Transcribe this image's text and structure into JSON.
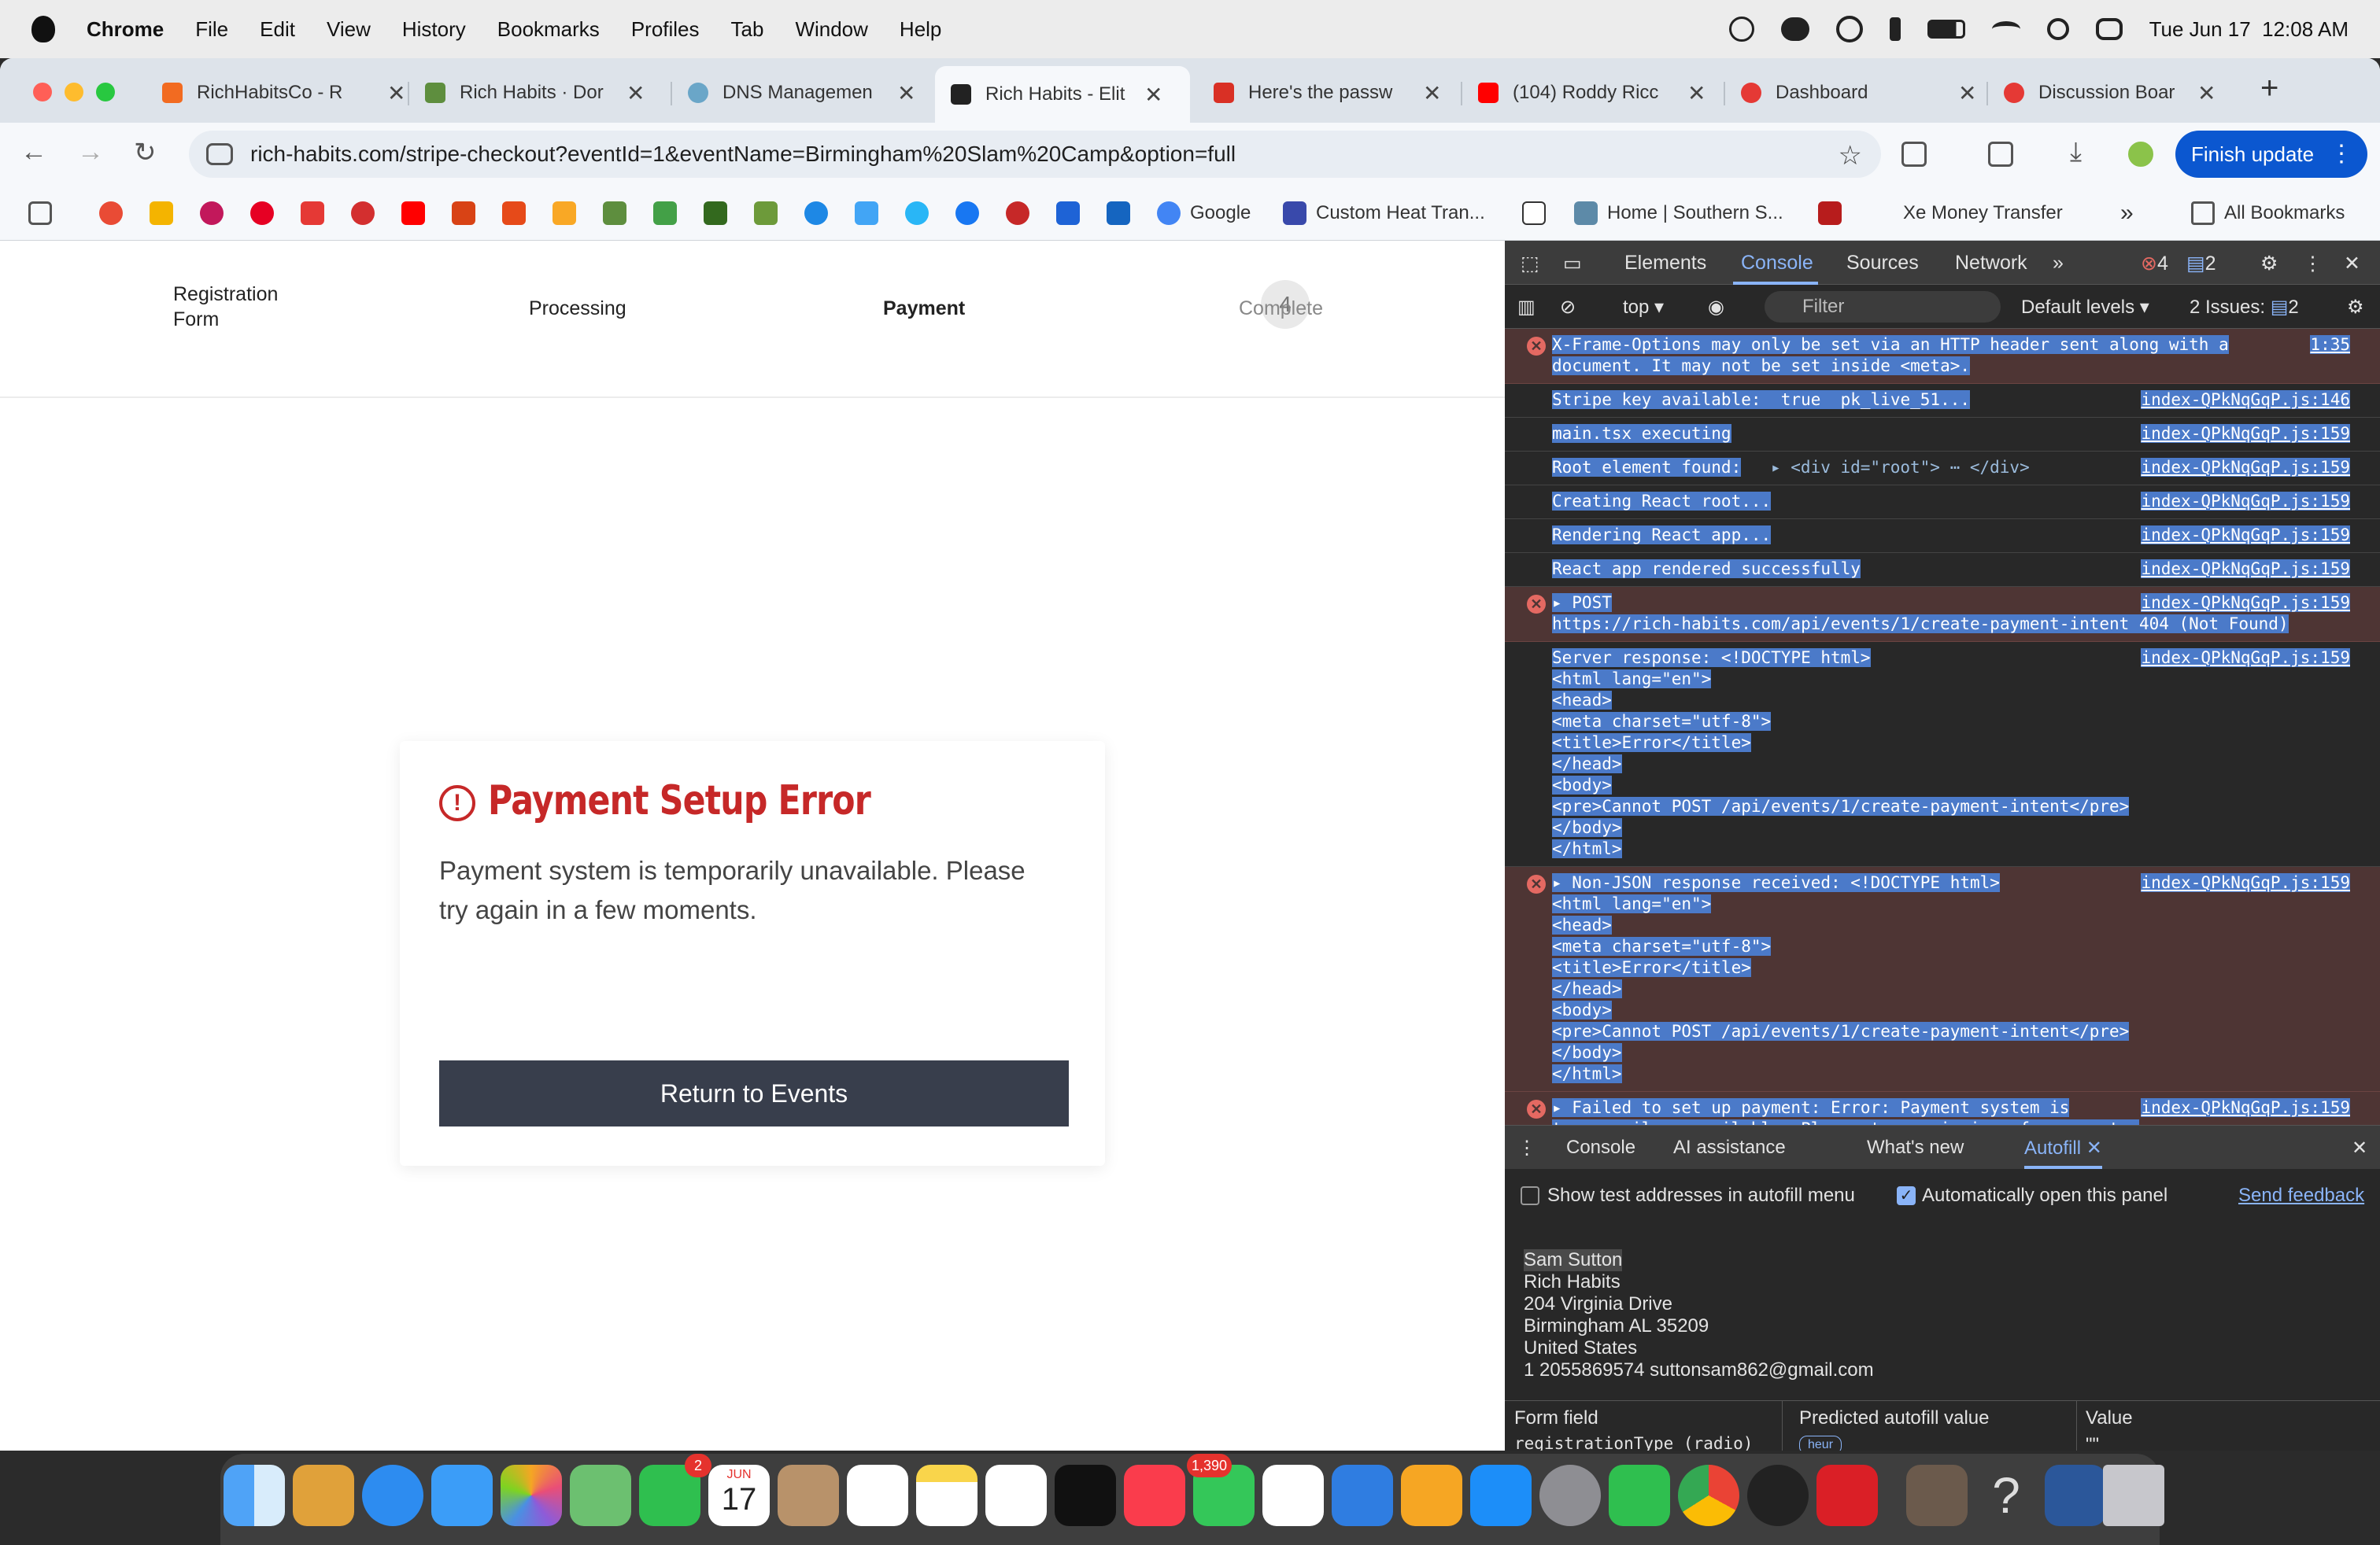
{
  "menubar": {
    "app": "Chrome",
    "menus": [
      "File",
      "Edit",
      "View",
      "History",
      "Bookmarks",
      "Profiles",
      "Tab",
      "Window",
      "Help"
    ],
    "datetime": "Tue Jun 17  12:08 AM"
  },
  "tabs": [
    {
      "title": "RichHabitsCo - R",
      "favicon_color": "#f26b21"
    },
    {
      "title": "Rich Habits · Dor",
      "favicon_color": "#5e8e3e"
    },
    {
      "title": "DNS Managemen",
      "favicon_color": "#6aa6c8"
    },
    {
      "title": "Rich Habits - Elit",
      "favicon_color": "#222222",
      "active": true
    },
    {
      "title": "Here's the passw",
      "favicon_color": "#d93025"
    },
    {
      "title": "(104) Roddy Ricc",
      "favicon_color": "#ff0000"
    },
    {
      "title": "Dashboard",
      "favicon_color": "#e53935"
    },
    {
      "title": "Discussion Boar",
      "favicon_color": "#e53935"
    }
  ],
  "toolbar": {
    "url": "rich-habits.com/stripe-checkout?eventId=1&eventName=Birmingham%20Slam%20Camp&option=full",
    "finish_update": "Finish update"
  },
  "bookmarks": {
    "google": "Google",
    "custom_heat": "Custom Heat Tran...",
    "home_southern": "Home | Southern S...",
    "xe": "Xe Money Transfer",
    "all": "All Bookmarks",
    "more": "»"
  },
  "steps": {
    "registration": "Registration\nForm",
    "processing": "Processing",
    "payment": "Payment",
    "complete_num": "4",
    "complete": "Complete"
  },
  "error_card": {
    "title": "Payment Setup Error",
    "message": "Payment system is temporarily unavailable. Please try again in a few moments.",
    "button": "Return to Events"
  },
  "devtools": {
    "tabs": [
      "Elements",
      "Console",
      "Sources",
      "Network"
    ],
    "error_count": "4",
    "message_count": "2",
    "context": "top",
    "filter_placeholder": "Filter",
    "levels": "Default levels",
    "issues_label": "2 Issues:",
    "issues_count": "2",
    "console_rows": [
      {
        "type": "error",
        "lines": [
          "X-Frame-Options may only be set via an HTTP header sent along with a",
          "document. It may not be set inside <meta>."
        ],
        "source": "1:35"
      },
      {
        "type": "log",
        "lines": [
          "Stripe key available:  true  pk_live_51..."
        ],
        "source": "index-QPkNqGqP.js:146"
      },
      {
        "type": "log",
        "lines": [
          "main.tsx executing"
        ],
        "source": "index-QPkNqGqP.js:159"
      },
      {
        "type": "log",
        "lines": [
          "Root element found:"
        ],
        "dom": "▸ <div id=\"root\"> ⋯ </div>",
        "source": "index-QPkNqGqP.js:159"
      },
      {
        "type": "log",
        "lines": [
          "Creating React root..."
        ],
        "source": "index-QPkNqGqP.js:159"
      },
      {
        "type": "log",
        "lines": [
          "Rendering React app..."
        ],
        "source": "index-QPkNqGqP.js:159"
      },
      {
        "type": "log",
        "lines": [
          "React app rendered successfully"
        ],
        "source": "index-QPkNqGqP.js:159"
      },
      {
        "type": "error",
        "lines": [
          "▸ POST",
          "https://rich-habits.com/api/events/1/create-payment-intent 404 (Not Found)"
        ],
        "source": "index-QPkNqGqP.js:159"
      },
      {
        "type": "log",
        "lines": [
          "Server response: <!DOCTYPE html>",
          "<html lang=\"en\">",
          "<head>",
          "<meta charset=\"utf-8\">",
          "<title>Error</title>",
          "</head>",
          "<body>",
          "<pre>Cannot POST /api/events/1/create-payment-intent</pre>",
          "</body>",
          "</html>"
        ],
        "source": "index-QPkNqGqP.js:159"
      },
      {
        "type": "error",
        "lines": [
          "▸ Non-JSON response received: <!DOCTYPE html>",
          "<html lang=\"en\">",
          "<head>",
          "<meta charset=\"utf-8\">",
          "<title>Error</title>",
          "</head>",
          "<body>",
          "<pre>Cannot POST /api/events/1/create-payment-intent</pre>",
          "</body>",
          "</html>"
        ],
        "source": "index-QPkNqGqP.js:159"
      },
      {
        "type": "error",
        "lines": [
          "▸ Failed to set up payment: Error: Payment system is",
          "temporarily unavailable. Please try again in a few moments."
        ],
        "source": "index-QPkNqGqP.js:159"
      }
    ],
    "drawer_tabs": [
      "Console",
      "AI assistance",
      "What's new",
      "Autofill"
    ],
    "autofill": {
      "show_test_addresses": "Show test addresses in autofill menu",
      "auto_open": "Automatically open this panel",
      "send_feedback": "Send feedback",
      "address_lines": [
        "Sam Sutton",
        "Rich Habits",
        "204 Virginia Drive",
        "Birmingham AL 35209",
        "United States",
        "1 2055869574 suttonsam862@gmail.com"
      ],
      "columns": [
        "Form field",
        "Predicted autofill value",
        "Value"
      ],
      "first_row": {
        "field": "registrationType (radio)",
        "predicted": "heur",
        "value": "\"\""
      }
    }
  },
  "dock": {
    "facetime_badge": "2",
    "calendar_month": "JUN",
    "calendar_day": "17",
    "messages_badge": "1,390"
  }
}
